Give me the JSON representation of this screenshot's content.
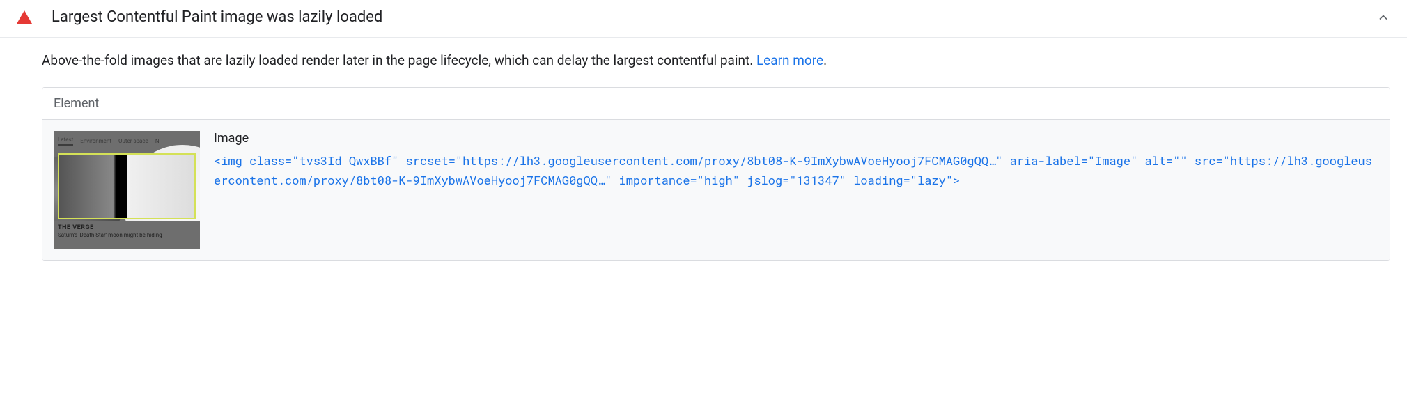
{
  "audit": {
    "title": "Largest Contentful Paint image was lazily loaded",
    "description_text": "Above-the-fold images that are lazily loaded render later in the page lifecycle, which can delay the largest contentful paint. ",
    "learn_more_label": "Learn more",
    "description_period": "."
  },
  "table": {
    "header": "Element",
    "row": {
      "label": "Image",
      "thumbnail": {
        "nav_items": [
          "Latest",
          "Environment",
          "Outer space",
          "N"
        ],
        "source_label": "THE VERGE",
        "caption": "Saturn's 'Death Star' moon might be hiding"
      },
      "code": {
        "tag_open": "<img ",
        "attrs": [
          {
            "name": "class",
            "value": "\"tvs3Id QwxBBf\""
          },
          {
            "name": "srcset",
            "value": "\"https://lh3.googleusercontent.com/proxy/8bt08-K-9ImXybwAVoeHyooj7FCMAG0gQQ…\""
          },
          {
            "name": "aria-label",
            "value": "\"Image\""
          },
          {
            "name": "alt",
            "value": "\"\""
          },
          {
            "name": "src",
            "value": "\"https://lh3.googleusercontent.com/proxy/8bt08-K-9ImXybwAVoeHyooj7FCMAG0gQQ…\""
          },
          {
            "name": "importance",
            "value": "\"high\""
          },
          {
            "name": "jslog",
            "value": "\"131347\""
          },
          {
            "name": "loading",
            "value": "\"lazy\""
          }
        ],
        "tag_close": ">"
      }
    }
  }
}
